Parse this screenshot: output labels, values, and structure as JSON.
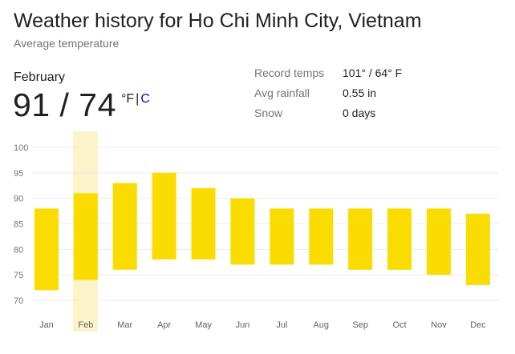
{
  "header": {
    "title": "Weather history for Ho Chi Minh City, Vietnam",
    "subtitle": "Average temperature"
  },
  "selected": {
    "month": "February",
    "temps": "91 / 74",
    "unit_f": "°F",
    "unit_sep": "|",
    "unit_c": "C"
  },
  "stats": [
    {
      "label": "Record temps",
      "value": "101° / 64° F"
    },
    {
      "label": "Avg rainfall",
      "value": "0.55 in"
    },
    {
      "label": "Snow",
      "value": "0 days"
    }
  ],
  "colors": {
    "bar": "#fbdc00",
    "highlight": "#fcf4c9",
    "grid": "#ebebeb"
  },
  "chart_data": {
    "type": "bar",
    "subtype": "floating-range",
    "categories": [
      "Jan",
      "Feb",
      "Mar",
      "Apr",
      "May",
      "Jun",
      "Jul",
      "Aug",
      "Sep",
      "Oct",
      "Nov",
      "Dec"
    ],
    "series": [
      {
        "values_high": [
          88,
          91,
          93,
          95,
          92,
          90,
          88,
          88,
          88,
          88,
          88,
          87
        ],
        "values_low": [
          72,
          74,
          76,
          78,
          78,
          77,
          77,
          77,
          76,
          76,
          75,
          73
        ]
      }
    ],
    "yticks": [
      100,
      95,
      90,
      85,
      80,
      75,
      70
    ],
    "ylim": [
      67,
      103
    ],
    "highlighted": "Feb",
    "grid": true
  }
}
